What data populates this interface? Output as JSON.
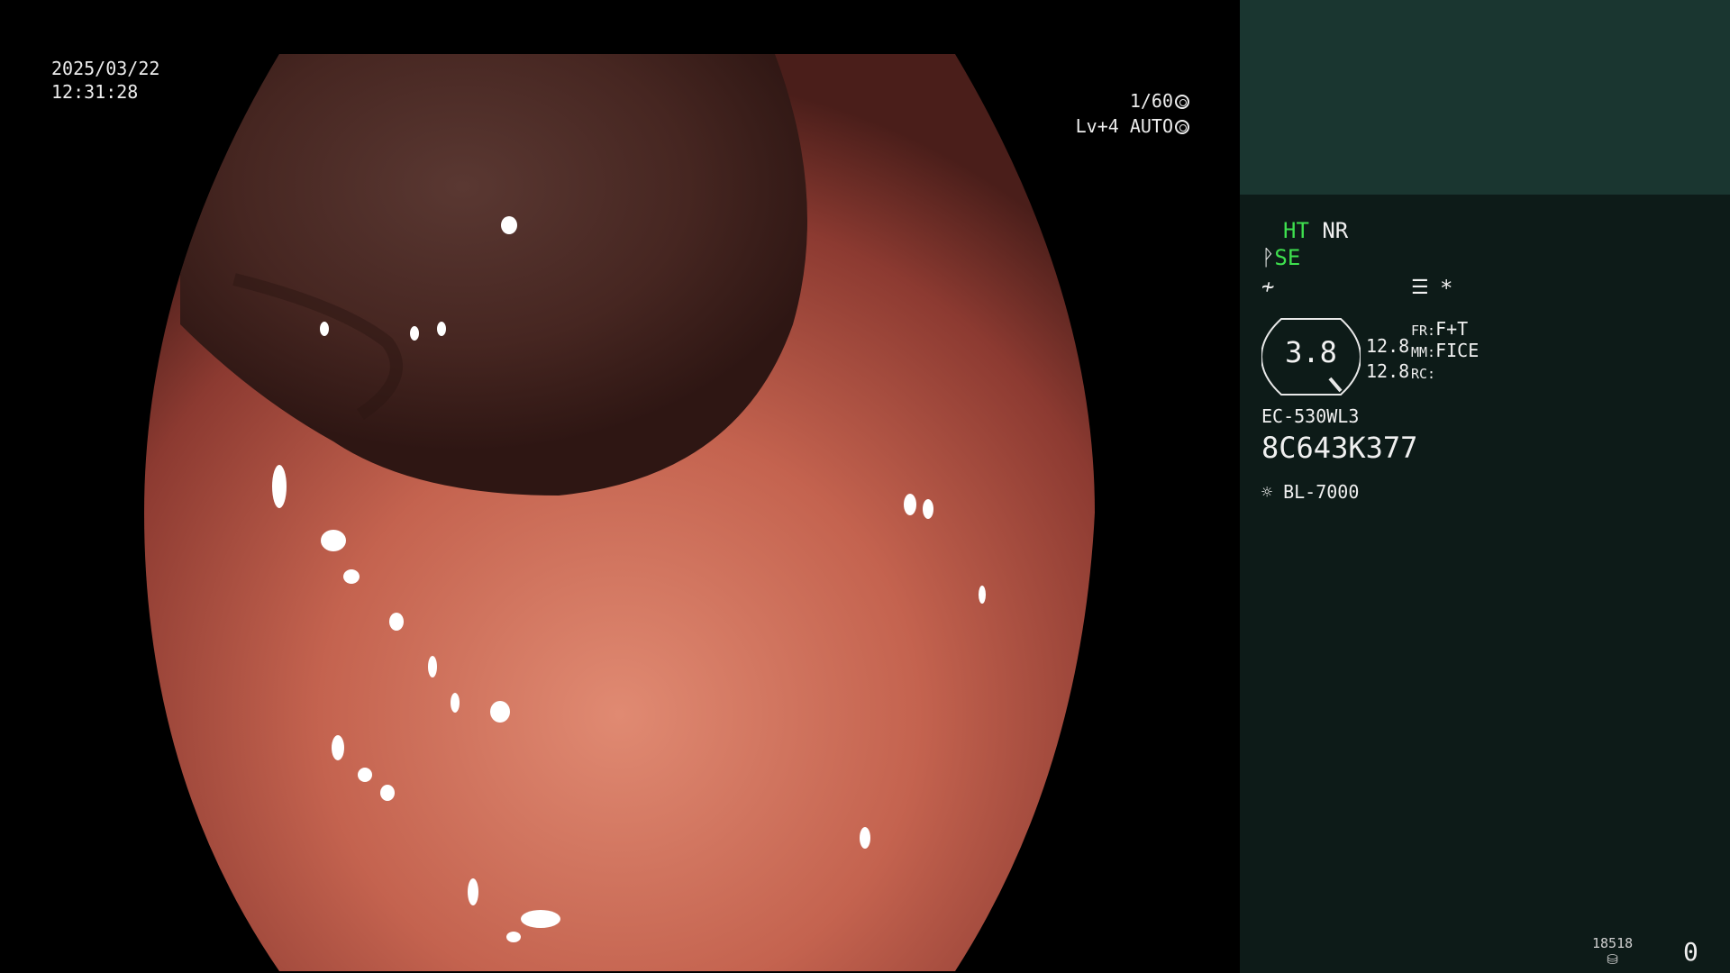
{
  "overlay": {
    "date": "2025/03/22",
    "time": "12:31:28",
    "shutter": "1/60",
    "level": "Lv+4 AUTO"
  },
  "panel": {
    "ht": "HT",
    "nr": "NR",
    "se": "SE",
    "asterisk": "*",
    "gauge_value": "3.8",
    "value_1": "12.8",
    "value_2": "12.8",
    "fr_label": "FR:",
    "fr_value": "F+T",
    "mm_label": "MM:",
    "mm_value": "FICE",
    "rc_label": "RC:",
    "scope_model": "EC-530WL3",
    "scope_serial": "8C643K377",
    "light_source": "BL-7000",
    "counter": "18518",
    "bottom_value": "0"
  },
  "colors": {
    "panel_bg": "#0d1b18",
    "panel_top_bg": "#1a3630",
    "accent_green": "#3ee04e",
    "tissue": "#b8574a",
    "lumen": "#4a2a24"
  },
  "icons": [
    "shutter-icon",
    "auto-iris-icon",
    "enhance-icon",
    "color-tone-icon",
    "settings-list-icon",
    "light-source-icon",
    "storage-icon"
  ]
}
